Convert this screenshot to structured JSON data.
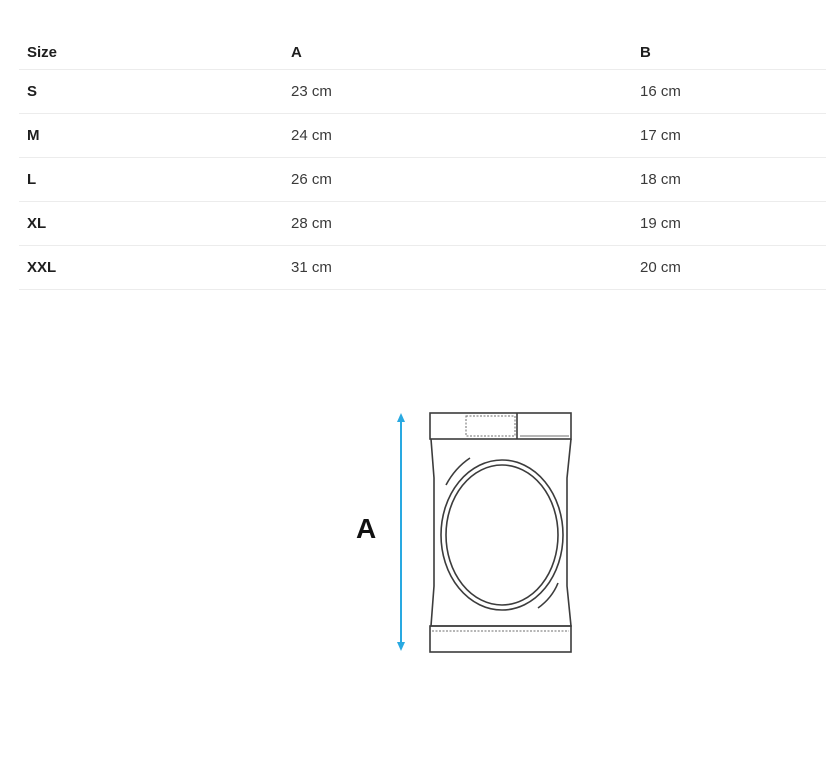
{
  "table": {
    "headers": [
      "Size",
      "A",
      "B"
    ],
    "rows": [
      {
        "size": "S",
        "a": "23 cm",
        "b": "16 cm"
      },
      {
        "size": "M",
        "a": "24 cm",
        "b": "17 cm"
      },
      {
        "size": "L",
        "a": "26 cm",
        "b": "18 cm"
      },
      {
        "size": "XL",
        "a": "28 cm",
        "b": "19 cm"
      },
      {
        "size": "XXL",
        "a": "31 cm",
        "b": "20 cm"
      }
    ]
  },
  "diagram": {
    "dimension_label": "A",
    "arrow_color": "#29a9e1",
    "line_color": "#3c3c3c"
  }
}
